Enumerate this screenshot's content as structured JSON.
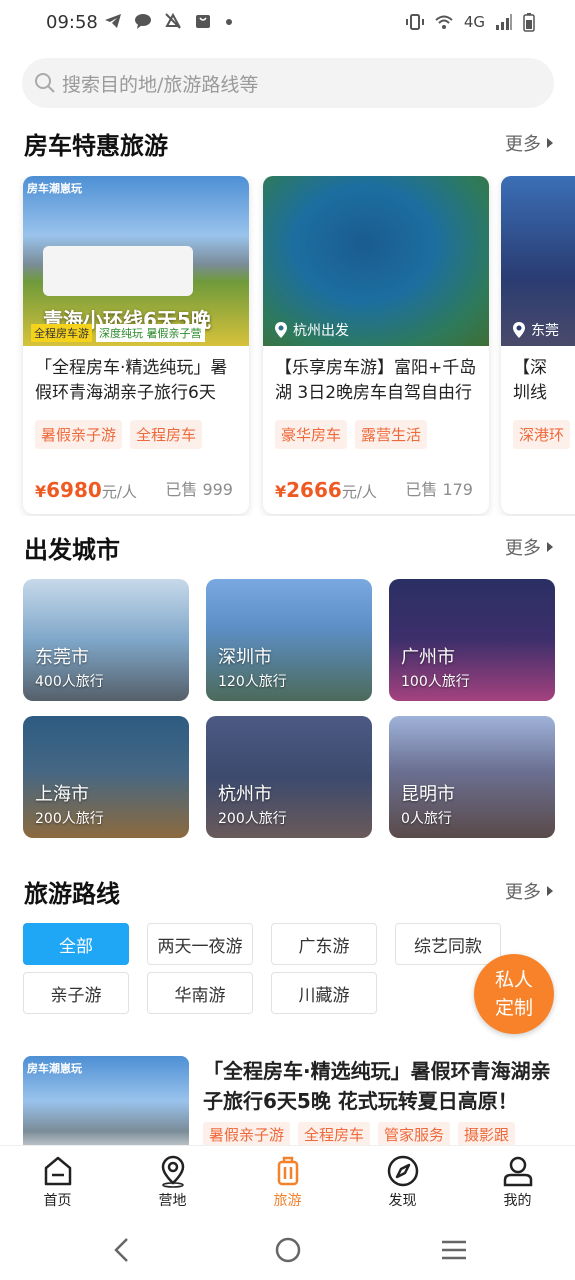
{
  "status": {
    "time": "09:58",
    "network": "4G"
  },
  "search": {
    "placeholder": "搜索目的地/旅游路线等"
  },
  "rv_section": {
    "title": "房车特惠旅游",
    "more": "更多",
    "cards": [
      {
        "image_text": "青海小环线6天5晚",
        "sub_text_1": "全程房车游",
        "sub_text_2": "深度纯玩 暑假亲子营",
        "logo_text": "房车潮崽玩",
        "title": "「全程房车·精选纯玩」暑假环青海湖亲子旅行6天5...",
        "tags": [
          "暑假亲子游",
          "全程房车"
        ],
        "currency": "¥",
        "price": "6980",
        "unit": "元/人",
        "sold": "已售 999"
      },
      {
        "badge": "杭州出发",
        "title": "【乐享房车游】富阳+千岛湖 3日2晚房车自驾自由行",
        "tags": [
          "豪华房车",
          "露营生活"
        ],
        "currency": "¥",
        "price": "2666",
        "unit": "元/人",
        "sold": "已售 179"
      },
      {
        "badge": "东莞",
        "title": "【深圳线游两",
        "tags": [
          "深港环"
        ]
      }
    ]
  },
  "city_section": {
    "title": "出发城市",
    "more": "更多",
    "cities": [
      {
        "name": "东莞市",
        "count": "400人旅行",
        "color": "#7fa7c9"
      },
      {
        "name": "深圳市",
        "count": "120人旅行",
        "color": "#5d8fc6"
      },
      {
        "name": "广州市",
        "count": "100人旅行",
        "color": "#3d2f6b"
      },
      {
        "name": "上海市",
        "count": "200人旅行",
        "color": "#456784"
      },
      {
        "name": "杭州市",
        "count": "200人旅行",
        "color": "#3c4a6e"
      },
      {
        "name": "昆明市",
        "count": "0人旅行",
        "color": "#6b7092"
      }
    ]
  },
  "route_section": {
    "title": "旅游路线",
    "more": "更多",
    "filters": [
      "全部",
      "两天一夜游",
      "广东游",
      "综艺同款",
      "亲子游",
      "华南游",
      "川藏游"
    ],
    "active_filter": "全部"
  },
  "fab": {
    "line1": "私人",
    "line2": "定制"
  },
  "list_item": {
    "logo_text": "房车潮崽玩",
    "title": "「全程房车·精选纯玩」暑假环青海湖亲子旅行6天5晚 花式玩转夏日高原！",
    "tags": [
      "暑假亲子游",
      "全程房车",
      "管家服务",
      "摄影跟"
    ]
  },
  "tabbar": {
    "items": [
      {
        "label": "首页",
        "icon": "home-icon"
      },
      {
        "label": "营地",
        "icon": "location-icon"
      },
      {
        "label": "旅游",
        "icon": "luggage-icon"
      },
      {
        "label": "发现",
        "icon": "compass-icon"
      },
      {
        "label": "我的",
        "icon": "user-icon"
      }
    ],
    "active": "旅游",
    "active_color": "#f3822d"
  },
  "colors": {
    "accent_orange": "#f3822d",
    "price_red": "#ef5a23",
    "chip_blue": "#1fa6f5"
  }
}
